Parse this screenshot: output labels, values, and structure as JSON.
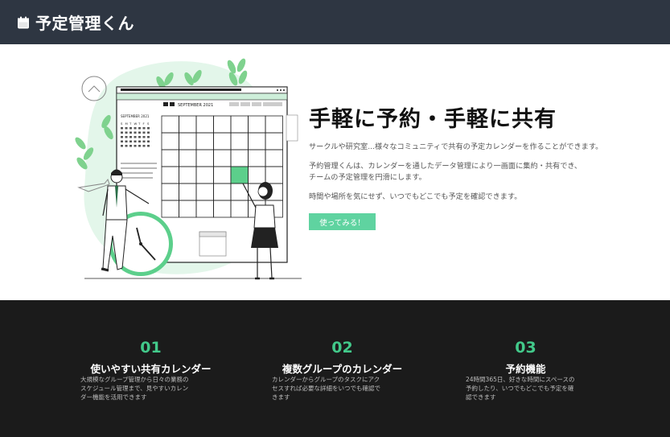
{
  "navbar": {
    "brand_icon": "calendar-icon",
    "brand": "予定管理くん"
  },
  "hero": {
    "title": "手軽に予約・手軽に共有",
    "p1": "サークルや研究室...様々なコミュニティで共有の予定カレンダーを作ることができます。",
    "p2_line1": "予約管理くんは、カレンダーを通したデータ管理により一画面に集約・共有でき、",
    "p2_line2": "チームの予定管理を円滑にします。",
    "p3": "時間や場所を気にせず、いつでもどこでも予定を確認できます。",
    "cta": "使ってみる！",
    "illustration": {
      "month_label": "SEPTEMBER 2021",
      "mini_month_label": "SEPTEMBER 2021",
      "weekday_letters": [
        "S",
        "M",
        "T",
        "W",
        "T",
        "F",
        "S"
      ]
    }
  },
  "features": [
    {
      "number": "01",
      "title": "使いやすい共有カレンダー",
      "desc": [
        "大規模なグループ管理から日々の業務の",
        "スケジュール管理まで、見やすいカレン",
        "ダー機能を活用できます"
      ]
    },
    {
      "number": "02",
      "title": "複数グループのカレンダー",
      "desc": [
        "カレンダーからグループのタスクにアク",
        "セスすれば必要な詳細をいつでも確認で",
        "きます"
      ]
    },
    {
      "number": "03",
      "title": "予約機能",
      "desc": [
        "24時間365日、好きな時間にスペースの",
        "予約したり、いつでもどこでも予定を確",
        "認できます"
      ]
    }
  ],
  "colors": {
    "navbar_bg": "#2e3642",
    "accent": "#5fd3a0",
    "feature_number": "#42c98a",
    "features_bg": "#1b1b1b"
  }
}
